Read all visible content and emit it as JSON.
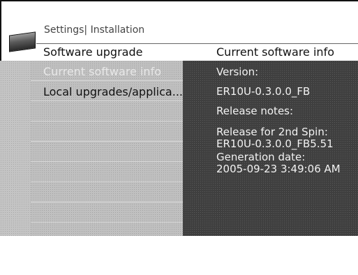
{
  "header": {
    "breadcrumb": "Settings| Installation",
    "left_title": "Software upgrade",
    "right_title": "Current software info"
  },
  "menu": {
    "items": [
      {
        "label": "Current software info",
        "state": "selected"
      },
      {
        "label": "Local upgrades/applica...",
        "state": "normal"
      },
      {
        "label": "",
        "state": "empty"
      },
      {
        "label": "",
        "state": "empty"
      },
      {
        "label": "",
        "state": "empty"
      },
      {
        "label": "",
        "state": "empty"
      },
      {
        "label": "",
        "state": "empty"
      },
      {
        "label": "",
        "state": "empty"
      }
    ]
  },
  "info": {
    "version_label": "Version:",
    "version_value": "ER10U-0.3.0.0_FB",
    "release_notes_label": "Release notes:",
    "release_line1": "Release for 2nd Spin:",
    "release_line2": "ER10U-0.3.0.0_FB5.51",
    "generation_label": "Generation date:",
    "generation_value": "2005-09-23 3:49:06 AM"
  },
  "colors": {
    "left_panel": "#c0c0c0",
    "right_panel": "#3f3f3f",
    "selected_text": "#e8e8e8"
  },
  "icons": {
    "logo": "tv-logo-icon"
  }
}
